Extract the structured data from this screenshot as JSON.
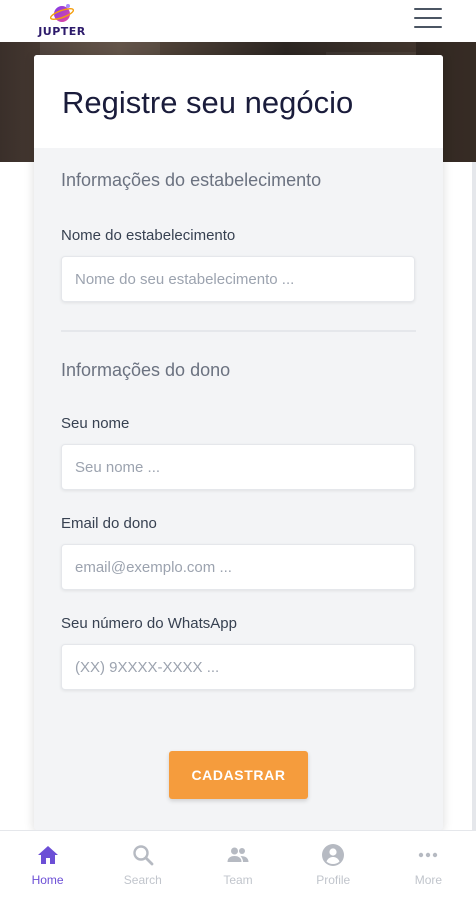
{
  "brand": {
    "name": "JUPTER"
  },
  "form": {
    "title": "Registre seu negócio",
    "section_business": "Informações do estabelecimento",
    "business_name_label": "Nome do estabelecimento",
    "business_name_placeholder": "Nome do seu estabelecimento ...",
    "business_name_value": "",
    "section_owner": "Informações do dono",
    "owner_name_label": "Seu nome",
    "owner_name_placeholder": "Seu nome ...",
    "owner_name_value": "",
    "owner_email_label": "Email do dono",
    "owner_email_placeholder": "email@exemplo.com ...",
    "owner_email_value": "",
    "whatsapp_label": "Seu número do WhatsApp",
    "whatsapp_placeholder": "(XX) 9XXXX-XXXX ...",
    "whatsapp_value": "",
    "submit_label": "CADASTRAR"
  },
  "bottom_nav": {
    "items": [
      {
        "label": "Home",
        "icon": "home-icon",
        "active": true
      },
      {
        "label": "Search",
        "icon": "search-icon",
        "active": false
      },
      {
        "label": "Team",
        "icon": "team-icon",
        "active": false
      },
      {
        "label": "Profile",
        "icon": "profile-icon",
        "active": false
      },
      {
        "label": "More",
        "icon": "more-icon",
        "active": false
      }
    ]
  },
  "colors": {
    "accent": "#6c4fd6",
    "submit": "#f59c3d",
    "inactive": "#c1c5cc",
    "title": "#1a1c3b"
  }
}
